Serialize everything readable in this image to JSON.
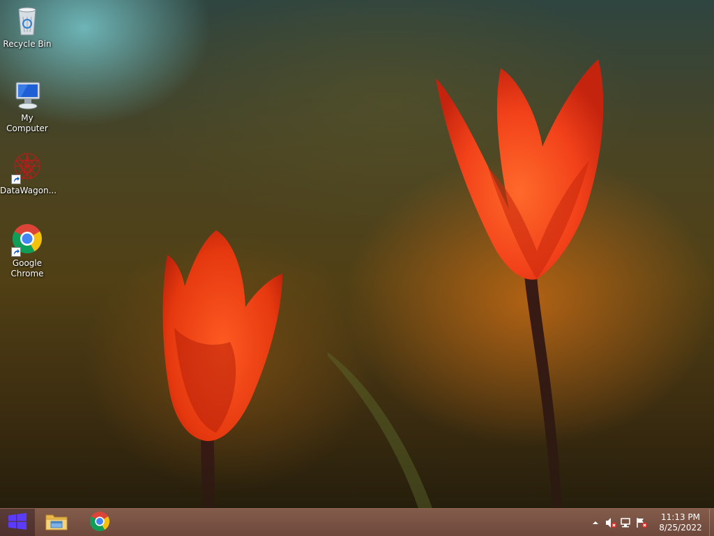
{
  "desktop": {
    "icons": [
      {
        "label": "Recycle Bin",
        "icon": "recycle-bin-icon"
      },
      {
        "label": "My Computer",
        "icon": "computer-icon"
      },
      {
        "label": "DataWagon...",
        "icon": "datawagon-icon",
        "shortcut": true
      },
      {
        "label": "Google Chrome",
        "icon": "chrome-icon",
        "shortcut": true
      }
    ]
  },
  "taskbar": {
    "start_icon": "windows-logo-icon",
    "pinned": [
      {
        "name": "File Explorer",
        "icon": "folder-icon"
      },
      {
        "name": "Google Chrome",
        "icon": "chrome-icon"
      }
    ],
    "tray": {
      "icons": [
        "show-hidden-icons-arrow",
        "volume-muted-icon",
        "network-icon",
        "action-center-icon"
      ],
      "clock": {
        "time": "11:13 PM",
        "date": "8/25/2022"
      }
    }
  },
  "colors": {
    "taskbar": "#6e4536",
    "tulip": "#f0451c",
    "start_tile": "#4c4cff"
  }
}
